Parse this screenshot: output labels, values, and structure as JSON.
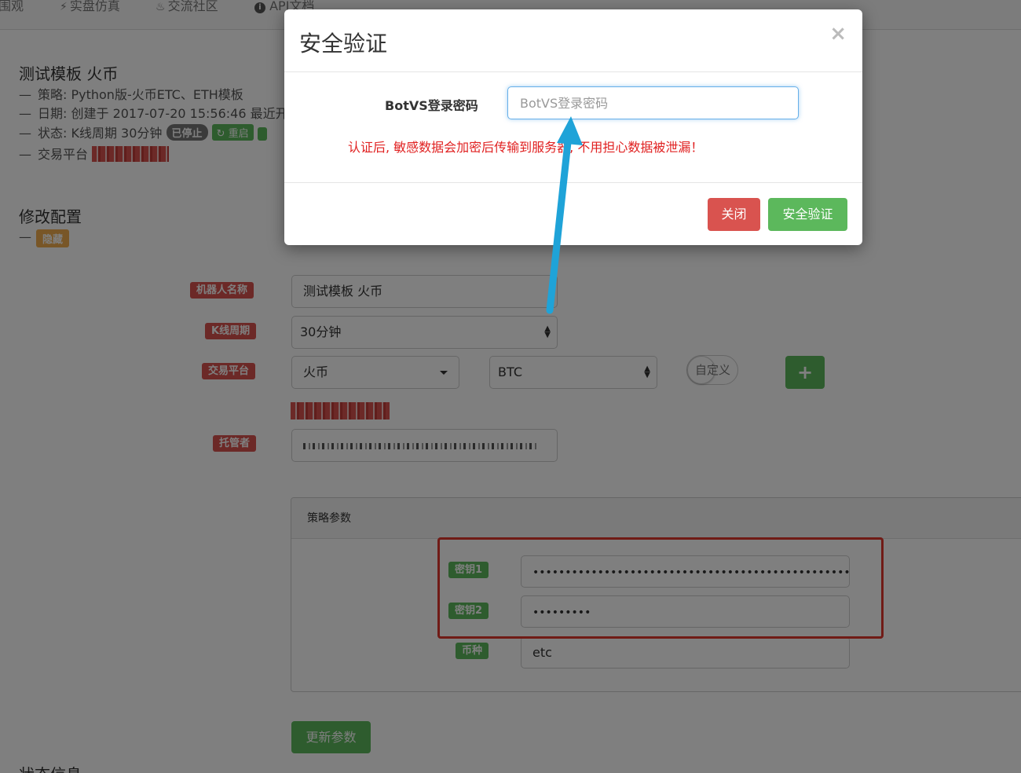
{
  "nav": {
    "items": [
      {
        "icon": "globe-icon",
        "label": "围观"
      },
      {
        "icon": "bolt-icon",
        "label": "实盘仿真"
      },
      {
        "icon": "fire-icon",
        "label": "交流社区"
      },
      {
        "icon": "info-icon",
        "label": "API文档"
      }
    ]
  },
  "robot": {
    "title": "测试模板 火币",
    "strategy": "策略: Python版-火币ETC、ETH模板",
    "date": "日期: 创建于 2017-07-20 15:56:46 最近开",
    "status_label": "状态: K线周期 30分钟",
    "status_badge": "已停止",
    "restart_label": "重启",
    "exchange_label": "交易平台"
  },
  "config": {
    "title": "修改配置",
    "hide_label": "隐藏",
    "fields": {
      "name_label": "机器人名称",
      "name_value": "测试模板 火币",
      "period_label": "K线周期",
      "period_value": "30分钟",
      "exchange_label": "交易平台",
      "exchange_value": "火币",
      "pair_value": "BTC",
      "custom_label": "自定义",
      "custodian_label": "托管者"
    }
  },
  "params": {
    "title": "策略参数",
    "rows": [
      {
        "label": "密钥1",
        "value": "••••••••••••••••••••••••••••••••••••••••••••••••••••••••••••••••••"
      },
      {
        "label": "密钥2",
        "value": "•••••••••"
      },
      {
        "label": "币种",
        "value": "etc"
      }
    ],
    "update_button": "更新参数"
  },
  "bottom_heading": "状态信息",
  "modal": {
    "title": "安全验证",
    "close_symbol": "×",
    "password_label": "BotVS登录密码",
    "password_placeholder": "BotVS登录密码",
    "warning": "认证后, 敏感数据会加密后传输到服务器, 不用担心数据被泄漏！",
    "close_button": "关闭",
    "verify_button": "安全验证"
  },
  "colors": {
    "danger": "#d9534f",
    "success": "#5cb85c",
    "warning": "#f0ad4e",
    "annotation_arrow": "#1fa3d8",
    "highlight_box": "#e0372d"
  }
}
